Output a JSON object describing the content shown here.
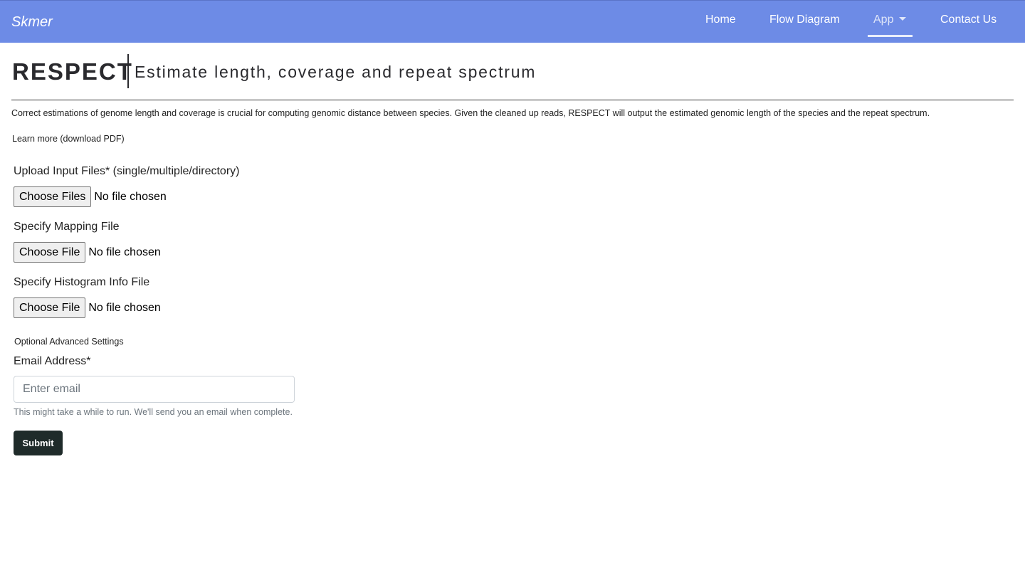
{
  "nav": {
    "brand": "Skmer",
    "items": [
      "Home",
      "Flow Diagram",
      "App",
      "Contact Us"
    ]
  },
  "header": {
    "title": "RESPECT",
    "subtitle": "Estimate length, coverage and repeat spectrum"
  },
  "intro": {
    "description": "Correct estimations of genome length and coverage is crucial for computing genomic distance between species. Given the cleaned up reads, RESPECT will output the estimated genomic length of the species and the repeat spectrum.",
    "learn_more": "Learn more (download PDF)"
  },
  "form": {
    "upload": {
      "label": "Upload Input Files* (single/multiple/directory)",
      "button": "Choose Files",
      "status": "No file chosen"
    },
    "mapping": {
      "label": "Specify Mapping File",
      "button": "Choose File",
      "status": "No file chosen"
    },
    "histogram": {
      "label": "Specify Histogram Info File",
      "button": "Choose File",
      "status": "No file chosen"
    },
    "advanced_label": "Optional Advanced Settings",
    "email": {
      "label": "Email Address*",
      "placeholder": "Enter email",
      "value": "",
      "help": "This might take a while to run. We'll send you an email when complete."
    },
    "submit_label": "Submit"
  },
  "colors": {
    "navbar": "#6d8be6",
    "submit": "#1f2b2a"
  }
}
